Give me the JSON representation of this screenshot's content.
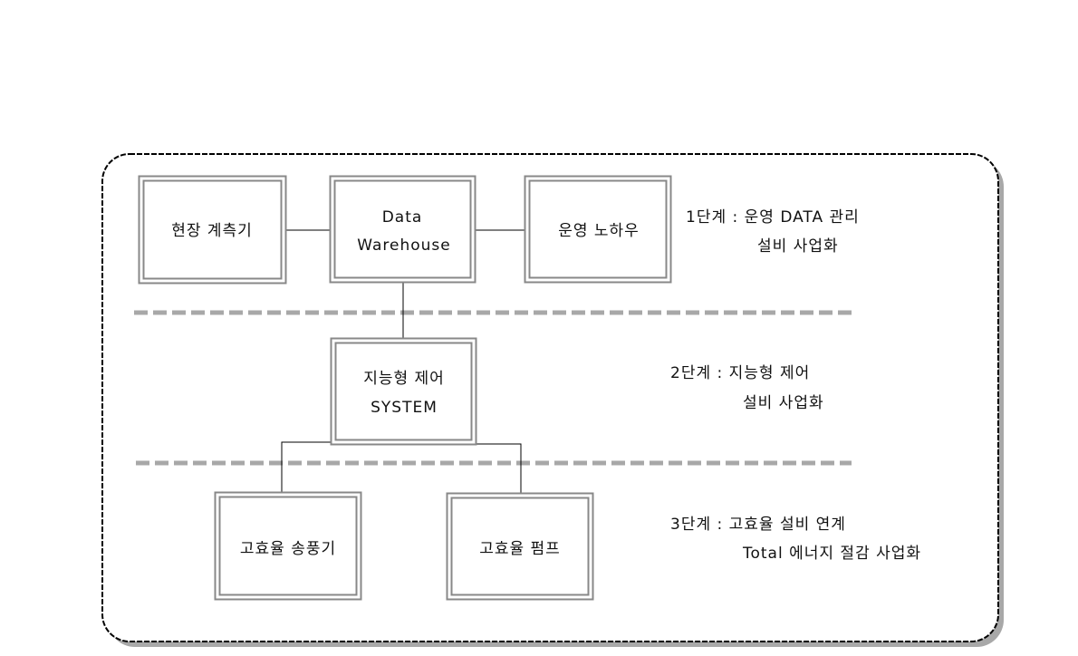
{
  "boxes": {
    "field_meter": "현장 계측기",
    "data_warehouse_line1": "Data",
    "data_warehouse_line2": "Warehouse",
    "ops_knowhow": "운영 노하우",
    "smart_control_line1": "지능형 제어",
    "smart_control_line2": "SYSTEM",
    "blower": "고효율 송풍기",
    "pump": "고효율 펌프"
  },
  "stages": {
    "stage1_line1": "1단계 : 운영 DATA 관리",
    "stage1_line2": "설비 사업화",
    "stage2_line1": "2단계 : 지능형 제어",
    "stage2_line2": "설비 사업화",
    "stage3_line1": "3단계 : 고효율 설비 연계",
    "stage3_line2": "Total 에너지 절감 사업화"
  },
  "colors": {
    "separator": "#a8a8a8",
    "shadow": "#a0a0a0",
    "border": "#888888"
  }
}
